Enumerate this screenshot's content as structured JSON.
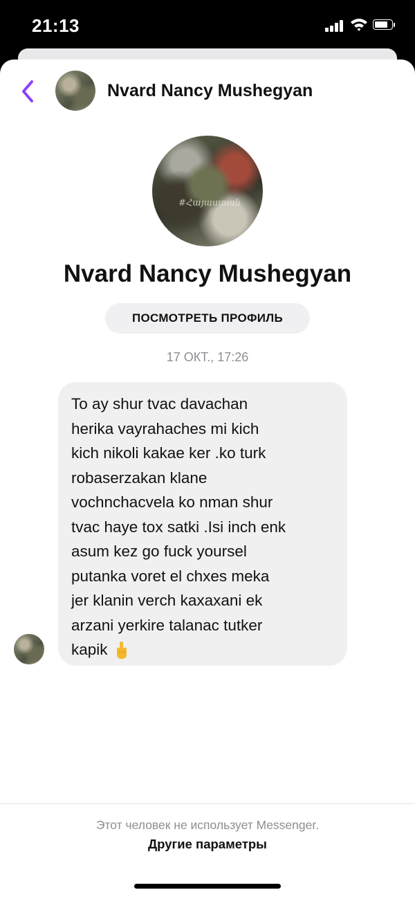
{
  "status_bar": {
    "time": "21:13"
  },
  "header": {
    "name": "Nvard Nancy Mushegyan"
  },
  "profile": {
    "name": "Nvard Nancy Mushegyan",
    "view_profile_label": "ПОСМОТРЕТЬ ПРОФИЛЬ",
    "avatar_watermark": "#Հայաստան"
  },
  "conversation": {
    "timestamp": "17 ОКТ., 17:26",
    "message_lines": [
      "To ay shur tvac davachan",
      "herika vayrahaches mi kich",
      "kich nikoli kakae ker .ko turk",
      "robaserzakan klane",
      "vochnchacvela ko nman shur",
      "tvac haye tox satki .Isi inch enk",
      "asum kez go fuck yoursel",
      "putanka voret el chxes meka",
      "jer klanin verch kaxaxani ek",
      "arzani yerkire talanac tutker",
      "kapik"
    ]
  },
  "footer": {
    "note": "Этот человек не использует Messenger.",
    "more_options_label": "Другие параметры"
  },
  "colors": {
    "accent": "#8a3ffc",
    "bubble": "#f0f0f0",
    "muted_text": "#8e8e93"
  }
}
